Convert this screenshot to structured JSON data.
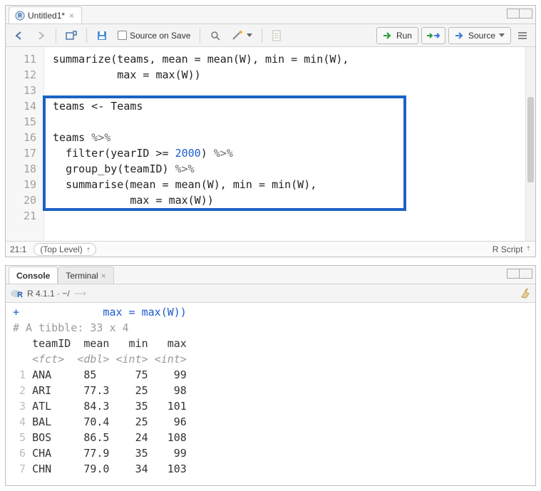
{
  "editor": {
    "tab_title": "Untitled1*",
    "toolbar": {
      "source_on_save": "Source on Save",
      "run": "Run",
      "source": "Source"
    },
    "first_line_number": 11,
    "lines": [
      {
        "n": 11,
        "segs": [
          {
            "t": "summarize",
            "c": "tok-fn"
          },
          {
            "t": "(teams, mean = ",
            "c": "tok-id"
          },
          {
            "t": "mean",
            "c": "tok-fn"
          },
          {
            "t": "(W), min = ",
            "c": "tok-id"
          },
          {
            "t": "min",
            "c": "tok-fn"
          },
          {
            "t": "(W),",
            "c": "tok-id"
          }
        ]
      },
      {
        "n": 12,
        "segs": [
          {
            "t": "          max = ",
            "c": "tok-id"
          },
          {
            "t": "max",
            "c": "tok-fn"
          },
          {
            "t": "(W))",
            "c": "tok-id"
          }
        ]
      },
      {
        "n": 13,
        "segs": []
      },
      {
        "n": 14,
        "segs": [
          {
            "t": "teams <- Teams",
            "c": "tok-id"
          }
        ]
      },
      {
        "n": 15,
        "segs": []
      },
      {
        "n": 16,
        "segs": [
          {
            "t": "teams ",
            "c": "tok-id"
          },
          {
            "t": "%>%",
            "c": "tok-pipe"
          }
        ]
      },
      {
        "n": 17,
        "segs": [
          {
            "t": "  ",
            "c": ""
          },
          {
            "t": "filter",
            "c": "tok-fn"
          },
          {
            "t": "(yearID >= ",
            "c": "tok-id"
          },
          {
            "t": "2000",
            "c": "tok-num"
          },
          {
            "t": ") ",
            "c": "tok-id"
          },
          {
            "t": "%>%",
            "c": "tok-pipe"
          }
        ]
      },
      {
        "n": 18,
        "segs": [
          {
            "t": "  ",
            "c": ""
          },
          {
            "t": "group_by",
            "c": "tok-fn"
          },
          {
            "t": "(teamID) ",
            "c": "tok-id"
          },
          {
            "t": "%>%",
            "c": "tok-pipe"
          }
        ]
      },
      {
        "n": 19,
        "segs": [
          {
            "t": "  ",
            "c": ""
          },
          {
            "t": "summarise",
            "c": "tok-fn"
          },
          {
            "t": "(mean = ",
            "c": "tok-id"
          },
          {
            "t": "mean",
            "c": "tok-fn"
          },
          {
            "t": "(W), min = ",
            "c": "tok-id"
          },
          {
            "t": "min",
            "c": "tok-fn"
          },
          {
            "t": "(W),",
            "c": "tok-id"
          }
        ]
      },
      {
        "n": 20,
        "segs": [
          {
            "t": "            max = ",
            "c": "tok-id"
          },
          {
            "t": "max",
            "c": "tok-fn"
          },
          {
            "t": "(W))",
            "c": "tok-id"
          }
        ]
      },
      {
        "n": 21,
        "segs": []
      }
    ],
    "status": {
      "pos": "21:1",
      "scope": "(Top Level)",
      "scope_sym": "⇡",
      "lang": "R Script",
      "lang_sym": "⇡"
    }
  },
  "console": {
    "tabs": {
      "console": "Console",
      "terminal": "Terminal"
    },
    "prompt_info": "R 4.1.1 · ~/",
    "cursor": "⟶",
    "lines": [
      {
        "kind": "code",
        "text": "+             max = max(W))"
      },
      {
        "kind": "comment",
        "text": "# A tibble: 33 x 4"
      },
      {
        "kind": "head",
        "text": "   teamID  mean   min   max"
      },
      {
        "kind": "type",
        "text": "   <fct>  <dbl> <int> <int>"
      },
      {
        "kind": "row",
        "idx": "1",
        "text": " ANA     85      75    99"
      },
      {
        "kind": "row",
        "idx": "2",
        "text": " ARI     77.3    25    98"
      },
      {
        "kind": "row",
        "idx": "3",
        "text": " ATL     84.3    35   101"
      },
      {
        "kind": "row",
        "idx": "4",
        "text": " BAL     70.4    25    96"
      },
      {
        "kind": "row",
        "idx": "5",
        "text": " BOS     86.5    24   108"
      },
      {
        "kind": "row",
        "idx": "6",
        "text": " CHA     77.9    35    99"
      },
      {
        "kind": "row",
        "idx": "7",
        "text": " CHN     79.0    34   103"
      }
    ]
  },
  "chart_data": {
    "type": "table",
    "title": "A tibble: 33 x 4",
    "columns": [
      "teamID",
      "mean",
      "min",
      "max"
    ],
    "col_types": [
      "fct",
      "dbl",
      "int",
      "int"
    ],
    "rows": [
      {
        "teamID": "ANA",
        "mean": 85,
        "min": 75,
        "max": 99
      },
      {
        "teamID": "ARI",
        "mean": 77.3,
        "min": 25,
        "max": 98
      },
      {
        "teamID": "ATL",
        "mean": 84.3,
        "min": 35,
        "max": 101
      },
      {
        "teamID": "BAL",
        "mean": 70.4,
        "min": 25,
        "max": 96
      },
      {
        "teamID": "BOS",
        "mean": 86.5,
        "min": 24,
        "max": 108
      },
      {
        "teamID": "CHA",
        "mean": 77.9,
        "min": 35,
        "max": 99
      },
      {
        "teamID": "CHN",
        "mean": 79.0,
        "min": 34,
        "max": 103
      }
    ],
    "total_rows": 33,
    "visible_rows": 7
  }
}
